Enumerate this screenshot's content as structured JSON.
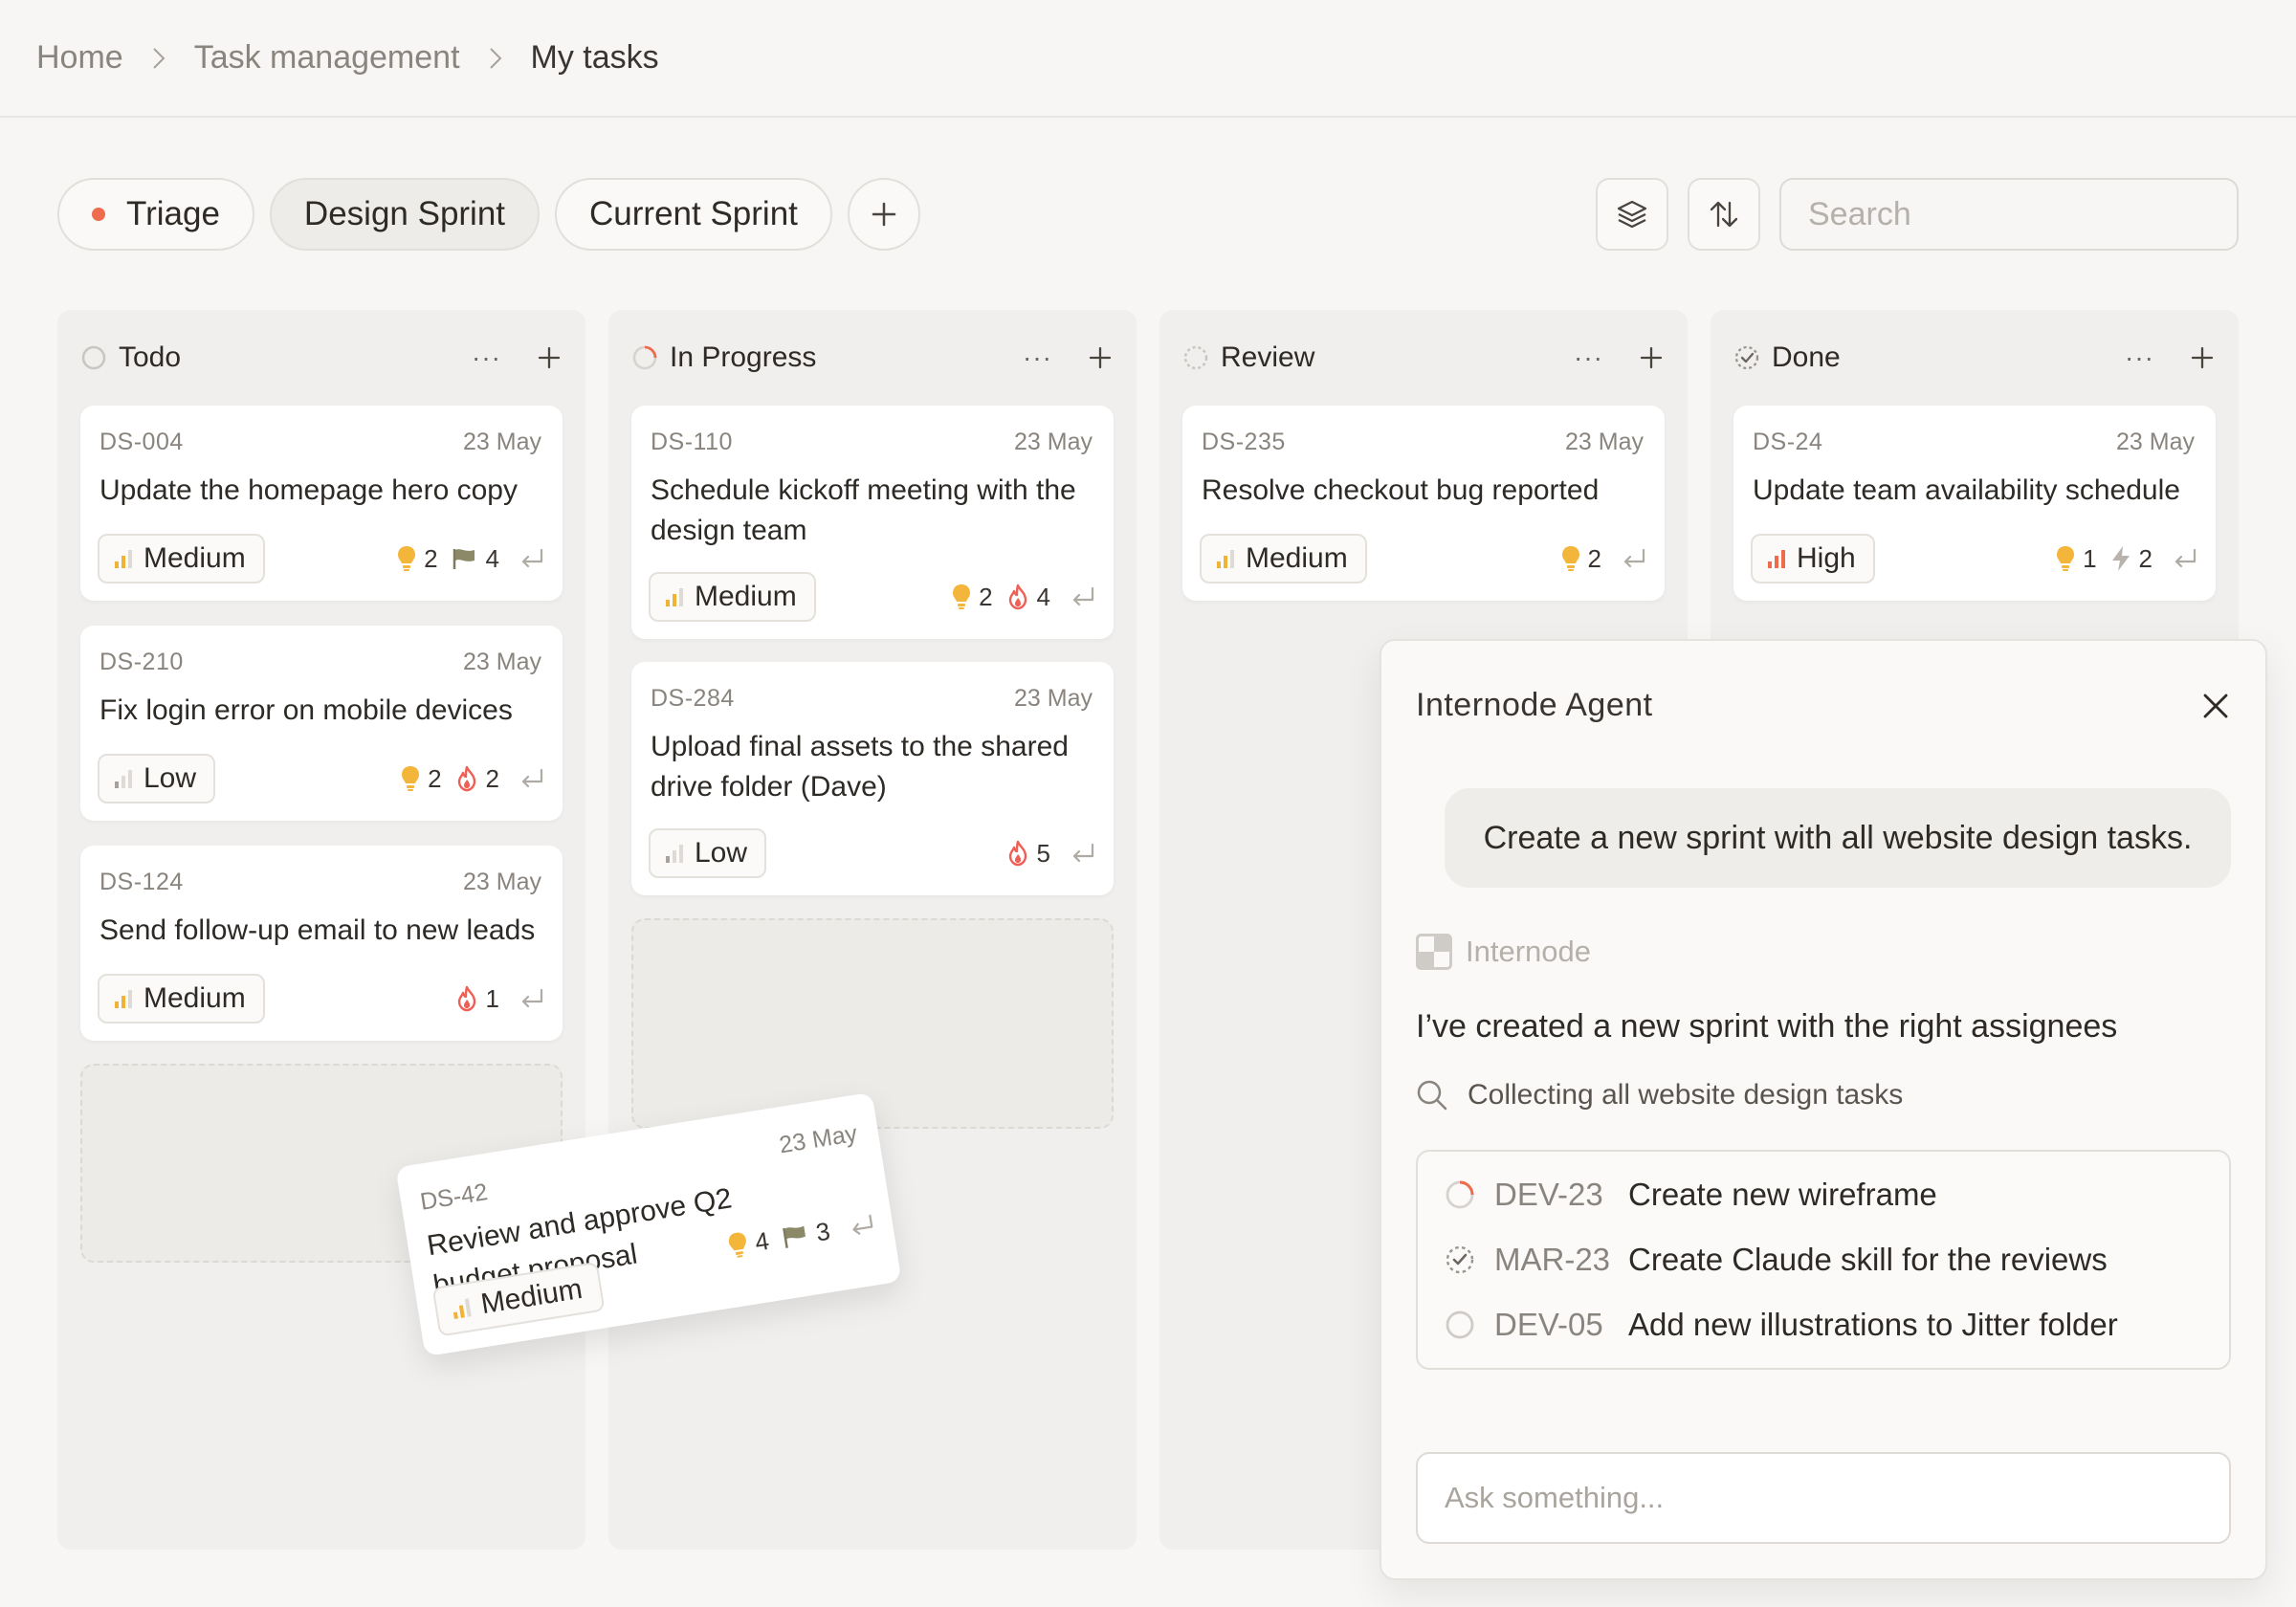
{
  "breadcrumb": {
    "home": "Home",
    "section": "Task management",
    "current": "My tasks"
  },
  "tabs": [
    {
      "label": "Triage",
      "dot_color": "#ef6b4d"
    },
    {
      "label": "Design Sprint"
    },
    {
      "label": "Current Sprint"
    }
  ],
  "toolbar": {
    "layers_icon": "layers-icon",
    "sort_icon": "sort-arrows-icon"
  },
  "search": {
    "placeholder": "Search"
  },
  "columns": [
    {
      "title": "Todo",
      "more": "···",
      "cards": [
        {
          "id": "DS-004",
          "date": "23 May",
          "title": "Update the homepage hero copy",
          "priority": "Medium",
          "bulb": "2",
          "flag": "4"
        },
        {
          "id": "DS-210",
          "date": "23 May",
          "title": "Fix login error on mobile devices",
          "priority": "Low",
          "bulb": "2",
          "fire": "2"
        },
        {
          "id": "DS-124",
          "date": "23 May",
          "title": "Send follow-up email to new leads",
          "priority": "Medium",
          "fire": "1"
        }
      ]
    },
    {
      "title": "In Progress",
      "more": "···",
      "cards": [
        {
          "id": "DS-110",
          "date": "23 May",
          "title": "Schedule kickoff meeting with the design team",
          "priority": "Medium",
          "bulb": "2",
          "fire": "4"
        },
        {
          "id": "DS-284",
          "date": "23 May",
          "title": "Upload final assets to the shared drive folder (Dave)",
          "priority": "Low",
          "fire": "5"
        }
      ]
    },
    {
      "title": "Review",
      "more": "···",
      "cards": [
        {
          "id": "DS-235",
          "date": "23 May",
          "title": "Resolve checkout bug reported",
          "priority": "Medium",
          "bulb": "2"
        }
      ]
    },
    {
      "title": "Done",
      "more": "···",
      "cards": [
        {
          "id": "DS-24",
          "date": "23 May",
          "title": "Update team availability schedule",
          "priority": "High",
          "bulb": "1",
          "bolt": "2"
        }
      ]
    }
  ],
  "dragged_card": {
    "id": "DS-42",
    "date": "23 May",
    "title": "Review and approve Q2 budget proposal",
    "priority": "Medium",
    "bulb": "4",
    "flag": "3"
  },
  "agent": {
    "title": "Internode Agent",
    "prompt": "Create a new sprint with all website design tasks.",
    "brand": "Internode",
    "answer": "I’ve created a new sprint with the right assignees",
    "collecting": "Collecting all website design tasks",
    "tasks": [
      {
        "id": "DEV-23",
        "name": "Create new wireframe",
        "status": "in-progress"
      },
      {
        "id": "MAR-23",
        "name": "Create Claude skill for the reviews",
        "status": "done"
      },
      {
        "id": "DEV-05",
        "name": "Add new illustrations to Jitter folder",
        "status": "todo"
      }
    ],
    "ask_placeholder": "Ask something..."
  },
  "colors": {
    "accent": "#ef6b4d",
    "medium": "#f2b233",
    "high": "#ef6b4d",
    "bulb": "#f4b63a",
    "fire": "#ef5f55"
  }
}
